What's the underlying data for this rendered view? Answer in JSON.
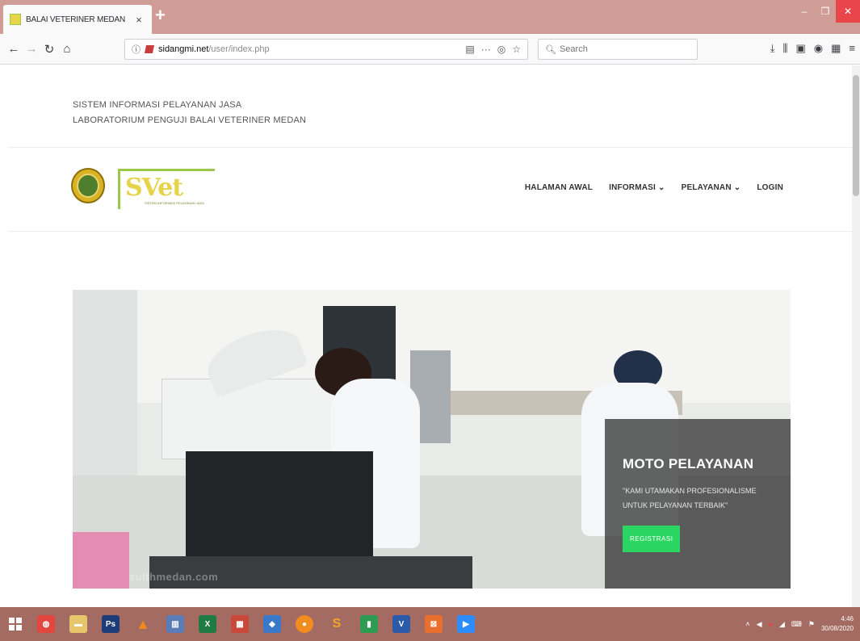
{
  "browser": {
    "tab_title": "BALAI VETERINER MEDAN",
    "tab_close": "×",
    "new_tab": "+",
    "url_host": "sidangmi.net",
    "url_path": "/user/index.php",
    "search_placeholder": "Search",
    "window_controls": {
      "minimize": "–",
      "maximize": "❐",
      "close": "✕"
    }
  },
  "site": {
    "header_line1": "SISTEM INFORMASI PELAYANAN JASA",
    "header_line2": "LABORATORIUM PENGUJI BALAI VETERINER MEDAN",
    "logo_text": "SVet",
    "logo_subtitle": "SISTEM INFORMASI PELAYANAN JASA",
    "nav": {
      "home": "HALAMAN AWAL",
      "info": "INFORMASI ⌄",
      "services": "PELAYANAN ⌄",
      "login": "LOGIN"
    }
  },
  "hero": {
    "title": "MOTO PELAYANAN",
    "text": "\"KAMI UTAMAKAN PROFESIONALISME UNTUK PELAYANAN TERBAIK\"",
    "button": "REGISTRASI",
    "watermark": "sulthmedan.com"
  },
  "taskbar": {
    "clock_time": "4:46",
    "clock_date": "30/08/2020"
  },
  "colors": {
    "titlebar": "#cf9d95",
    "taskbar": "#a46b62",
    "accent_green": "#2bd561"
  }
}
